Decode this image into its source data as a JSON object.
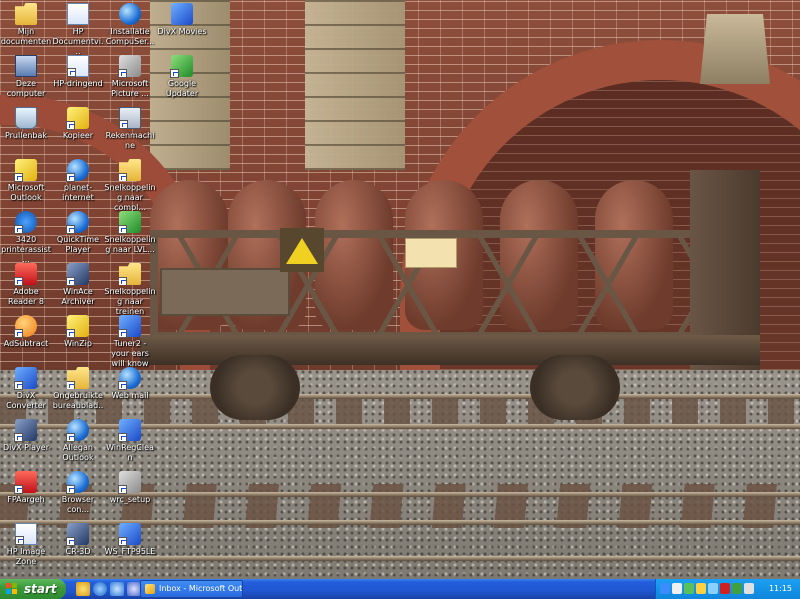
{
  "desktop": {
    "icons": [
      {
        "id": "mijn-documenten",
        "label": "Mijn documenten",
        "glyph": "folder"
      },
      {
        "id": "hp-documentviewer",
        "label": "HP Documentvi...",
        "glyph": "docs"
      },
      {
        "id": "installatie-compuserve",
        "label": "Installatie CompuSer...",
        "glyph": "globe"
      },
      {
        "id": "divx-movies",
        "label": "DivX Movies",
        "glyph": "blue"
      },
      {
        "id": "deze-computer",
        "label": "Deze computer",
        "glyph": "pc"
      },
      {
        "id": "hp-dringend",
        "label": "HP-dringend",
        "glyph": "docs"
      },
      {
        "id": "microsoft-picture",
        "label": "Microsoft Picture ...",
        "glyph": "gray"
      },
      {
        "id": "google-updater",
        "label": "Google Updater",
        "glyph": "green"
      },
      {
        "id": "prullenbak",
        "label": "Prullenbak",
        "glyph": "bin"
      },
      {
        "id": "kopieer",
        "label": "Kopieer",
        "glyph": "yellow"
      },
      {
        "id": "rekenmachine",
        "label": "Rekenmachine",
        "glyph": "calc"
      },
      {
        "id": "microsoft-outlook",
        "label": "Microsoft Outlook",
        "glyph": "yellow"
      },
      {
        "id": "planet-internet",
        "label": "planet-internet",
        "glyph": "globe"
      },
      {
        "id": "snelkoppeling-complex",
        "label": "Snelkoppeling naar compl...",
        "glyph": "folder"
      },
      {
        "id": "hp-3420",
        "label": "3420 printerassist...",
        "glyph": "hp"
      },
      {
        "id": "quicktime-player",
        "label": "QuickTime Player",
        "glyph": "globe"
      },
      {
        "id": "snelkoppeling-lvl",
        "label": "Snelkoppeling naar LVL...",
        "glyph": "green"
      },
      {
        "id": "adobe-reader",
        "label": "Adobe Reader 8",
        "glyph": "red"
      },
      {
        "id": "winace-archiver",
        "label": "WinAce Archiver",
        "glyph": "dark"
      },
      {
        "id": "snelkoppeling-treinen",
        "label": "Snelkoppeling naar treinen",
        "glyph": "folder"
      },
      {
        "id": "adsubtract",
        "label": "AdSubtract",
        "glyph": "orange"
      },
      {
        "id": "winzip",
        "label": "WinZip",
        "glyph": "yellow"
      },
      {
        "id": "tuner2",
        "label": "Tuner2 - your ears will know",
        "glyph": "blue"
      },
      {
        "id": "divx-converter",
        "label": "DivX Converter",
        "glyph": "blue"
      },
      {
        "id": "ongebruikte-bureaublad",
        "label": "Ongebruikte bureaublad...",
        "glyph": "folder"
      },
      {
        "id": "web-mail",
        "label": "Web mail",
        "glyph": "globe"
      },
      {
        "id": "divx-player",
        "label": "DivX Player",
        "glyph": "dark"
      },
      {
        "id": "allegan-outlook",
        "label": "Allegan Outlook",
        "glyph": "globe"
      },
      {
        "id": "winregclean",
        "label": "WinRegClean",
        "glyph": "blue"
      },
      {
        "id": "fpaargeh",
        "label": "FPAargeh",
        "glyph": "red"
      },
      {
        "id": "browser-con",
        "label": "Browser con...",
        "glyph": "globe"
      },
      {
        "id": "wrc-setup",
        "label": "wrc_setup",
        "glyph": "gray"
      },
      {
        "id": "hp-image-zone",
        "label": "HP Image Zone",
        "glyph": "docs"
      },
      {
        "id": "cr-3d",
        "label": "CR-3D",
        "glyph": "dark"
      },
      {
        "id": "ws-ftp95le",
        "label": "WS_FTP95LE",
        "glyph": "blue"
      }
    ]
  },
  "taskbar": {
    "start_label": "start",
    "quick_launch": [
      "outlook-icon",
      "internet-explorer-icon",
      "ie-icon",
      "show-desktop-icon"
    ],
    "task_button": "Inbox - Microsoft Out...",
    "clock": "11:15",
    "colors": {
      "taskbar": "#245edb",
      "start": "#3c9a3c",
      "tray": "#0f86dc"
    }
  }
}
